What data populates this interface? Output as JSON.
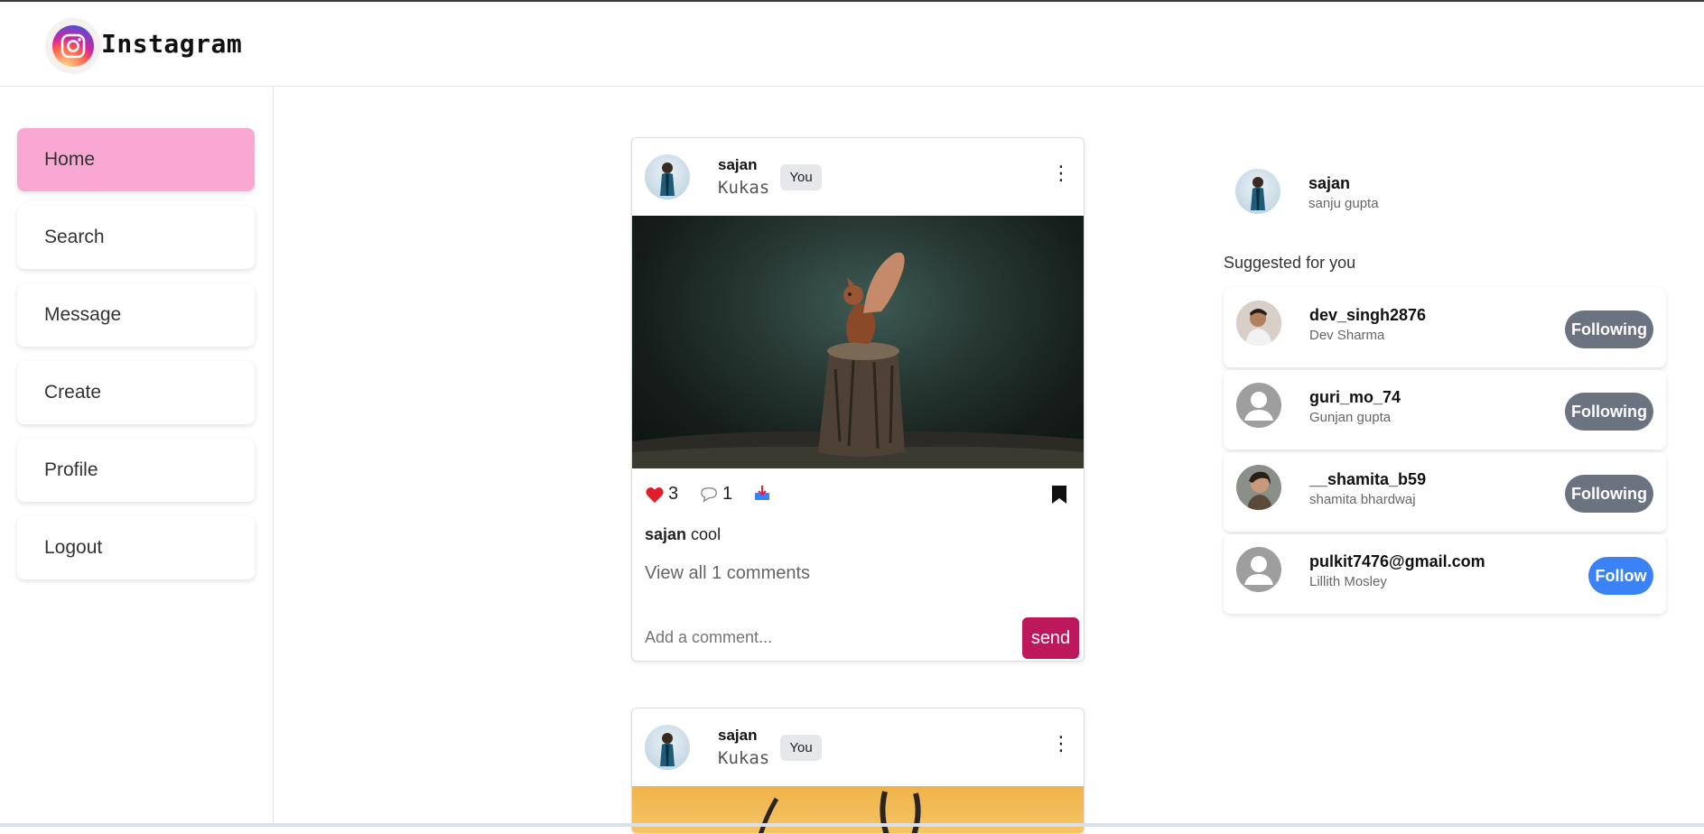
{
  "header": {
    "logo_text": "Instagram"
  },
  "sidebar": {
    "items": [
      {
        "label": "Home",
        "active": true
      },
      {
        "label": "Search"
      },
      {
        "label": "Message"
      },
      {
        "label": "Create"
      },
      {
        "label": "Profile"
      },
      {
        "label": "Logout"
      }
    ]
  },
  "posts": [
    {
      "username": "sajan",
      "subtitle": "Kukas",
      "badge": "You",
      "likes": "3",
      "comments": "1",
      "caption_user": "sajan",
      "caption_text": "cool",
      "view_all": "View all 1 comments",
      "comment_placeholder": "Add a comment...",
      "send_label": "send"
    },
    {
      "username": "sajan",
      "subtitle": "Kukas",
      "badge": "You"
    }
  ],
  "right": {
    "profile": {
      "username": "sajan",
      "name": "sanju gupta"
    },
    "suggested_title": "Suggested for you",
    "suggestions": [
      {
        "username": "dev_singh2876",
        "name": "Dev Sharma",
        "button": "Following"
      },
      {
        "username": "guri_mo_74",
        "name": "Gunjan gupta",
        "button": "Following"
      },
      {
        "username": "__shamita_b59",
        "name": "shamita bhardwaj",
        "button": "Following"
      },
      {
        "username": "pulkit7476@gmail.com",
        "name": "Lillith Mosley",
        "button": "Follow"
      }
    ]
  },
  "colors": {
    "active_nav": "#f9a8d4",
    "send_button": "#be185d",
    "following_button": "#6b7280",
    "follow_button": "#3b82f6"
  },
  "icons": [
    "instagram-logo-icon",
    "heart-icon",
    "comment-icon",
    "share-icon",
    "bookmark-icon",
    "more-vertical-icon",
    "default-user-icon"
  ]
}
